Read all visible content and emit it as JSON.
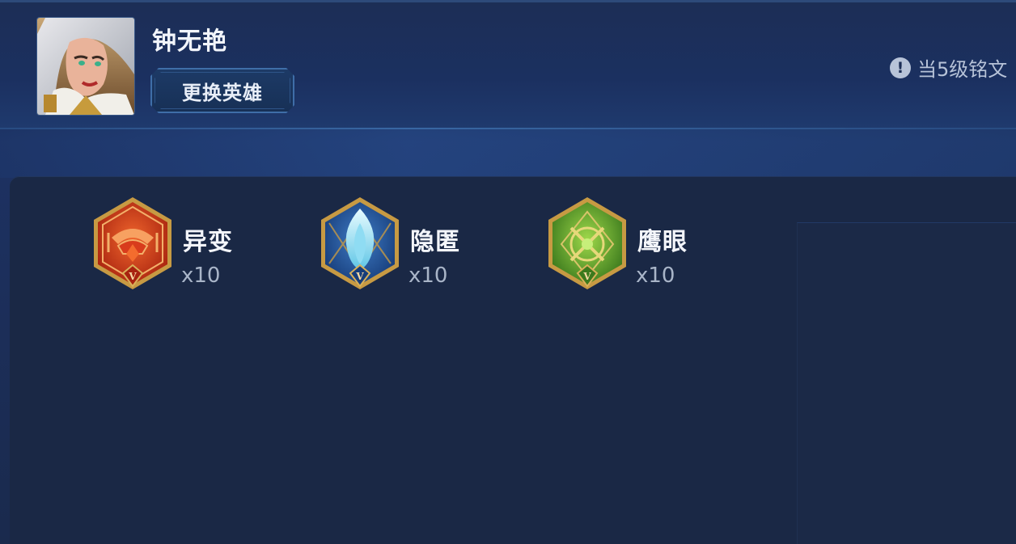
{
  "hero": {
    "name": "钟无艳",
    "change_button_label": "更换英雄"
  },
  "notice": {
    "icon": "exclamation-circle-icon",
    "text": "当5级铭文"
  },
  "runes": [
    {
      "name": "异变",
      "count": "x10",
      "level": "V",
      "color": "#c8331a",
      "icon": "red-rune-icon"
    },
    {
      "name": "隐匿",
      "count": "x10",
      "level": "V",
      "color": "#2a5fa8",
      "icon": "blue-rune-icon"
    },
    {
      "name": "鹰眼",
      "count": "x10",
      "level": "V",
      "color": "#5aa02c",
      "icon": "green-rune-icon"
    }
  ],
  "colors": {
    "background": "#1a2a4d",
    "panel": "#1a2845",
    "button_border": "#3f6ea8"
  }
}
